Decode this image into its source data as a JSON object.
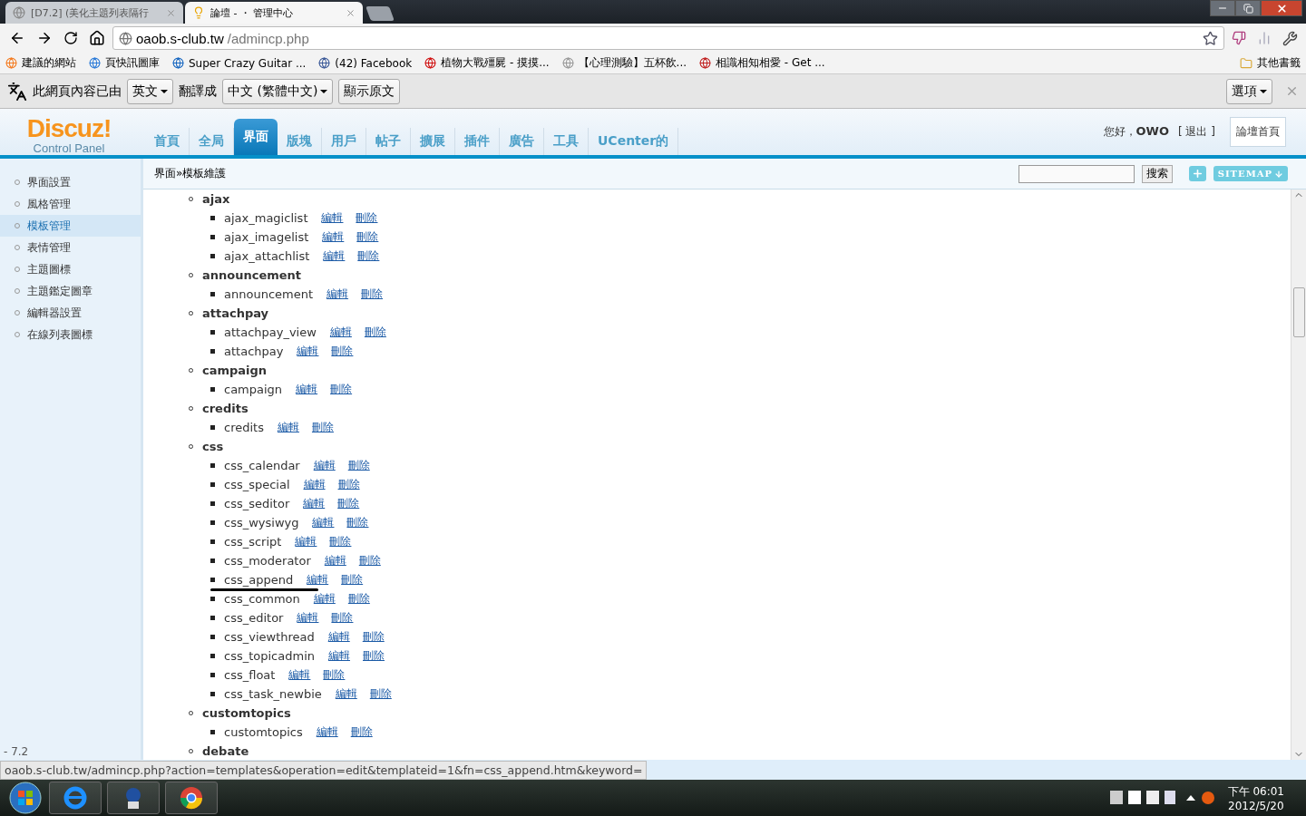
{
  "browser": {
    "tabs": [
      {
        "title": "[D7.2] (美化主題列表隔行",
        "selected": false
      },
      {
        "title": "論壇 - ・ 管理中心",
        "selected": true
      }
    ],
    "address": {
      "host": "oaob.s-club.tw",
      "path": "/admincp.php"
    },
    "bookmarks": [
      "建議的網站",
      "頁快訊圖庫",
      "Super Crazy Guitar ...",
      "(42) Facebook",
      "植物大戰殭屍 - 摸摸...",
      "【心理測驗】五杯飲...",
      "相識相知相愛 - Get ..."
    ],
    "other_bookmarks": "其他書籤",
    "translate_bar": {
      "label": "此網頁內容已由",
      "from": "英文",
      "to_label": "翻譯成",
      "to": "中文 (繁體中文)",
      "show_original": "顯示原文",
      "options": "選項"
    }
  },
  "admin": {
    "logo": {
      "brand": "Discuz!",
      "subtitle": "Control Panel"
    },
    "nav": [
      {
        "label": "首頁",
        "selected": false
      },
      {
        "label": "全局",
        "selected": false
      },
      {
        "label": "界面",
        "selected": true
      },
      {
        "label": "版塊",
        "selected": false
      },
      {
        "label": "用戶",
        "selected": false
      },
      {
        "label": "帖子",
        "selected": false
      },
      {
        "label": "擴展",
        "selected": false
      },
      {
        "label": "插件",
        "selected": false
      },
      {
        "label": "廣告",
        "selected": false
      },
      {
        "label": "工具",
        "selected": false
      },
      {
        "label": "UCenter的",
        "selected": false
      }
    ],
    "user": {
      "greeting": "您好，",
      "name": "OWO",
      "logout": "[ 退出 ]"
    },
    "forum_home": "論壇首頁",
    "breadcrumb": "界面»模板維護",
    "search_button": "搜索",
    "sitemap": "SITEMAP",
    "sidebar": [
      {
        "label": "界面設置",
        "selected": false
      },
      {
        "label": "風格管理",
        "selected": false
      },
      {
        "label": "模板管理",
        "selected": true
      },
      {
        "label": "表情管理",
        "selected": false
      },
      {
        "label": "主題圖標",
        "selected": false
      },
      {
        "label": "主題鑑定圖章",
        "selected": false
      },
      {
        "label": "編輯器設置",
        "selected": false
      },
      {
        "label": "在線列表圖標",
        "selected": false
      }
    ],
    "version": "- 7.2",
    "groups": [
      {
        "name": "ajax",
        "templates": [
          {
            "name": "ajax_magiclist",
            "edit": "編輯",
            "delete": "刪除",
            "hovered": false
          },
          {
            "name": "ajax_imagelist",
            "edit": "編輯",
            "delete": "刪除",
            "hovered": false
          },
          {
            "name": "ajax_attachlist",
            "edit": "編輯",
            "delete": "刪除",
            "hovered": false
          }
        ]
      },
      {
        "name": "announcement",
        "templates": [
          {
            "name": "announcement",
            "edit": "編輯",
            "delete": "刪除",
            "hovered": false
          }
        ]
      },
      {
        "name": "attachpay",
        "templates": [
          {
            "name": "attachpay_view",
            "edit": "編輯",
            "delete": "刪除",
            "hovered": false
          },
          {
            "name": "attachpay",
            "edit": "編輯",
            "delete": "刪除",
            "hovered": false
          }
        ]
      },
      {
        "name": "campaign",
        "templates": [
          {
            "name": "campaign",
            "edit": "編輯",
            "delete": "刪除",
            "hovered": false
          }
        ]
      },
      {
        "name": "credits",
        "templates": [
          {
            "name": "credits",
            "edit": "編輯",
            "delete": "刪除",
            "hovered": false
          }
        ]
      },
      {
        "name": "css",
        "templates": [
          {
            "name": "css_calendar",
            "edit": "編輯",
            "delete": "刪除",
            "hovered": false
          },
          {
            "name": "css_special",
            "edit": "編輯",
            "delete": "刪除",
            "hovered": false
          },
          {
            "name": "css_seditor",
            "edit": "編輯",
            "delete": "刪除",
            "hovered": false
          },
          {
            "name": "css_wysiwyg",
            "edit": "編輯",
            "delete": "刪除",
            "hovered": false
          },
          {
            "name": "css_script",
            "edit": "編輯",
            "delete": "刪除",
            "hovered": false
          },
          {
            "name": "css_moderator",
            "edit": "編輯",
            "delete": "刪除",
            "hovered": false
          },
          {
            "name": "css_append",
            "edit": "編輯",
            "delete": "刪除",
            "hovered": true
          },
          {
            "name": "css_common",
            "edit": "編輯",
            "delete": "刪除",
            "hovered": false
          },
          {
            "name": "css_editor",
            "edit": "編輯",
            "delete": "刪除",
            "hovered": false
          },
          {
            "name": "css_viewthread",
            "edit": "編輯",
            "delete": "刪除",
            "hovered": false
          },
          {
            "name": "css_topicadmin",
            "edit": "編輯",
            "delete": "刪除",
            "hovered": false
          },
          {
            "name": "css_float",
            "edit": "編輯",
            "delete": "刪除",
            "hovered": false
          },
          {
            "name": "css_task_newbie",
            "edit": "編輯",
            "delete": "刪除",
            "hovered": false
          }
        ]
      },
      {
        "name": "customtopics",
        "templates": [
          {
            "name": "customtopics",
            "edit": "編輯",
            "delete": "刪除",
            "hovered": false
          }
        ]
      },
      {
        "name": "debate"
      }
    ]
  },
  "status_url": "oaob.s-club.tw/admincp.php?action=templates&operation=edit&templateid=1&fn=css_append.htm&keyword=",
  "clock": {
    "time": "下午 06:01",
    "date": "2012/5/20"
  }
}
